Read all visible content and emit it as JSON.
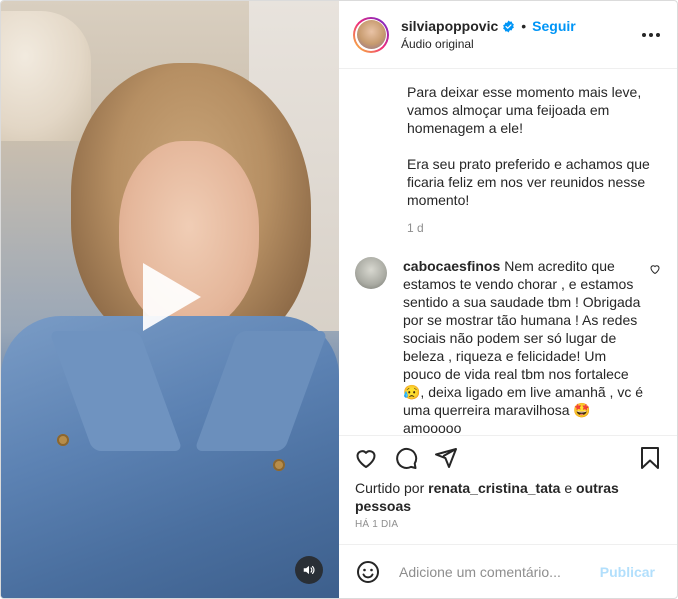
{
  "header": {
    "username": "silviapoppovic",
    "separator": "•",
    "follow_label": "Seguir",
    "audio_label": "Áudio original"
  },
  "caption": {
    "paragraphs": [
      "Para deixar esse momento mais leve, vamos almoçar uma feijoada em homenagem a ele!",
      "Era seu prato preferido e achamos que ficaria feliz em nos ver reunidos nesse momento!"
    ],
    "time_ago": "1 d"
  },
  "comment": {
    "username": "cabocaesfinos",
    "text": "Nem acredito que estamos te vendo chorar , e estamos sentido a sua saudade tbm ! Obrigada por se mostrar tão humana ! As redes sociais não podem ser só lugar de beleza , riqueza e felicidade! Um pouco de vida real tbm nos fortalece 😥, deixa ligado em live amanhã , vc é uma querreira maravilhosa 🤩amooooo"
  },
  "likes": {
    "prefix": "Curtido por",
    "user": "renata_cristina_tata",
    "middle": "e",
    "others": "outras pessoas"
  },
  "timestamp": "Há 1 dia",
  "add_comment": {
    "placeholder": "Adicione um comentário...",
    "publish_label": "Publicar"
  },
  "icons": {
    "verified": "verified-badge-icon",
    "more": "more-options-icon",
    "like": "heart-icon",
    "comment": "comment-bubble-icon",
    "share": "paper-plane-icon",
    "save": "bookmark-icon",
    "emoji": "emoji-smile-icon",
    "play": "play-icon",
    "audio": "speaker-icon"
  },
  "colors": {
    "accent": "#0095f6",
    "publish_disabled": "#b2dffc",
    "muted_text": "#8e8e8e"
  }
}
